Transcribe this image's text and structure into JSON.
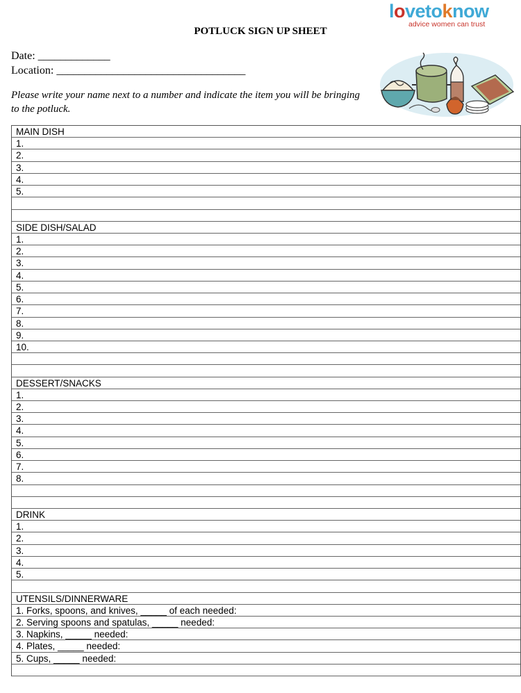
{
  "brand": {
    "name_parts": [
      "l",
      "o",
      "veto",
      "k",
      "now"
    ],
    "tagline": "advice women can trust",
    "colors": {
      "blue": "#3fa9d6",
      "red": "#c8342b",
      "orange": "#e07a2a"
    }
  },
  "header": {
    "title": "POTLUCK SIGN UP SHEET",
    "date_label": "Date: _____________",
    "location_label": "Location: __________________________________",
    "instructions": "Please write your name next to a number and indicate the item you will be bringing to the potluck."
  },
  "illustration": {
    "icon": "potluck-food-illustration"
  },
  "sections": [
    {
      "name": "main-dish",
      "title": "MAIN DISH",
      "items": [
        "1.",
        "2.",
        "3.",
        "4.",
        "5."
      ],
      "blank_rows": 2
    },
    {
      "name": "side-dish-salad",
      "title": "SIDE DISH/SALAD",
      "items": [
        "1.",
        "2.",
        "3.",
        "4.",
        "5.",
        "6.",
        "7.",
        "8.",
        "9.",
        "10."
      ],
      "blank_rows": 2
    },
    {
      "name": "dessert-snacks",
      "title": "DESSERT/SNACKS",
      "items": [
        "1.",
        "2.",
        "3.",
        "4.",
        "5.",
        "6.",
        "7.",
        "8."
      ],
      "blank_rows": 2
    },
    {
      "name": "drink",
      "title": "DRINK",
      "items": [
        "1.",
        "2.",
        "3.",
        "4.",
        "5."
      ],
      "blank_rows": 1
    },
    {
      "name": "utensils-dinnerware",
      "title": "UTENSILS/DINNERWARE",
      "items": [
        "1. Forks, spoons, and knives, _____ of each needed:",
        "2. Serving spoons and spatulas, _____ needed:",
        "3. Napkins, _____ needed:",
        "4. Plates, _____ needed:",
        "5. Cups, _____ needed:"
      ],
      "blank_rows": 1
    }
  ]
}
